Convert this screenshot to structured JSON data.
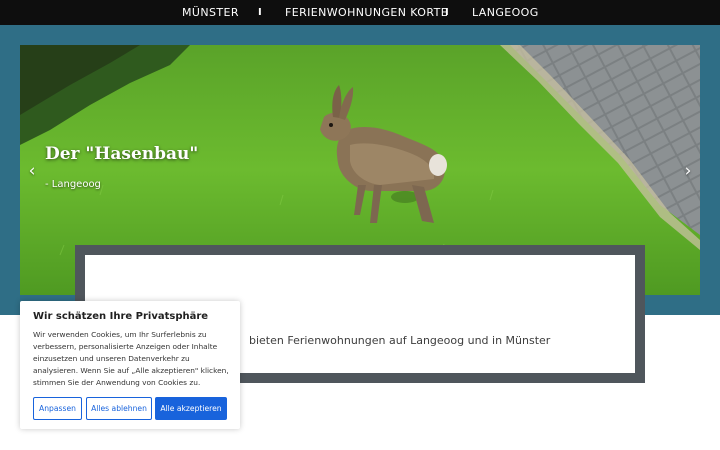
{
  "nav": {
    "items": [
      "MÜNSTER",
      "FERIENWOHNUNGEN KORTE",
      "LANGEOOG"
    ],
    "separator": "I"
  },
  "hero": {
    "title": "Der \"Hasenbau\"",
    "subtitle": "- Langeoog",
    "prev_arrow": "‹",
    "next_arrow": "›",
    "image_icon": "rabbit-on-lawn-photo"
  },
  "content": {
    "text": "bieten Ferienwohnungen auf Langeoog und in Münster"
  },
  "cookie": {
    "title": "Wir schätzen Ihre Privatsphäre",
    "body": "Wir verwenden Cookies, um Ihr Surferlebnis zu verbessern, personalisierte Anzeigen oder Inhalte einzusetzen und unseren Datenverkehr zu analysieren. Wenn Sie auf „Alle akzeptieren\" klicken, stimmen Sie der Anwendung von Cookies zu.",
    "btn_customize": "Anpassen",
    "btn_reject": "Alles ablehnen",
    "btn_accept": "Alle akzeptieren"
  },
  "colors": {
    "nav_bg": "#0e0e0e",
    "band": "#2f6e86",
    "card_frame": "#4f565c",
    "accent": "#1863dc"
  }
}
